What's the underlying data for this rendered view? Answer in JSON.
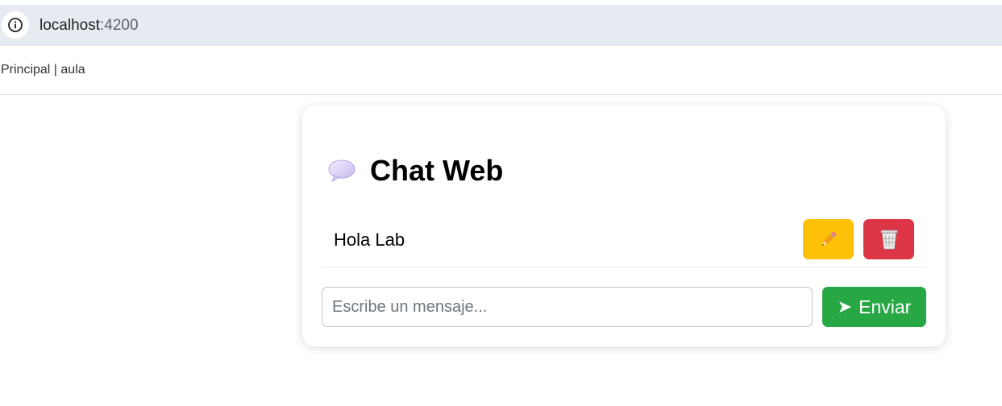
{
  "browser": {
    "url_host": "localhost",
    "url_port": ":4200"
  },
  "nav": {
    "text": "Principal | aula"
  },
  "chat": {
    "title": "Chat Web",
    "title_icon": "speech-balloon-icon",
    "messages": [
      {
        "text": "Hola Lab",
        "edit_icon": "pencil-icon",
        "delete_icon": "wastebasket-icon"
      }
    ],
    "input_placeholder": "Escribe un mensaje...",
    "input_value": "",
    "send_label": "Enviar",
    "send_icon": "arrow-right-icon"
  },
  "colors": {
    "address_bar": "#e6ebf2",
    "edit_button": "#ffc107",
    "delete_button": "#dc3545",
    "send_button": "#28a745"
  }
}
